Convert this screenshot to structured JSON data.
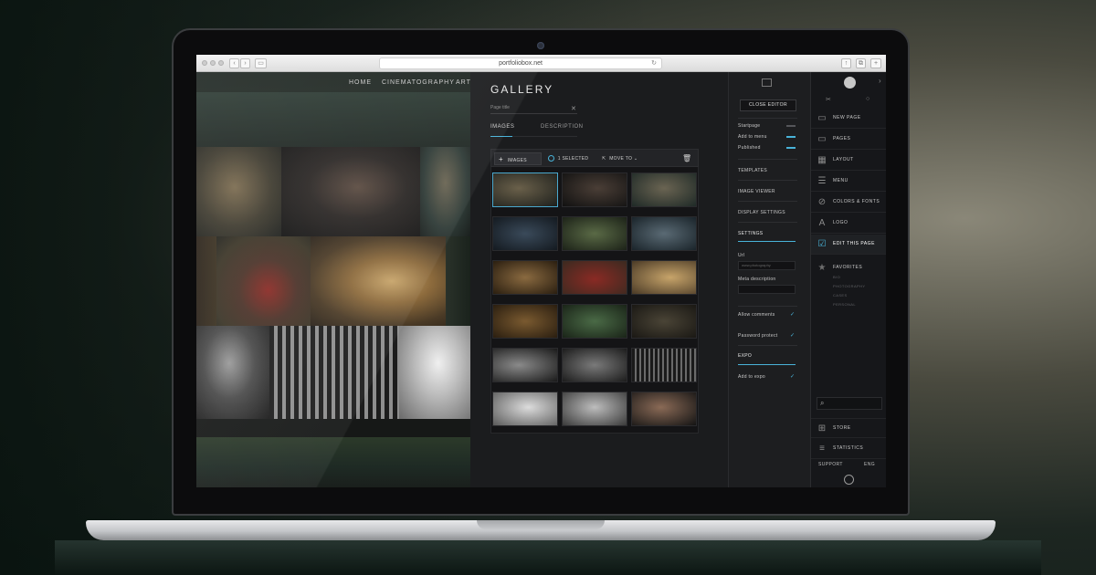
{
  "browser": {
    "url": "portfoliobox.net"
  },
  "site": {
    "nav": [
      "HOME",
      "CINEMATOGRAPHY",
      "ART"
    ]
  },
  "gallery": {
    "title": "GALLERY",
    "page_title_placeholder": "Page title",
    "close_glyph": "✕",
    "tabs": [
      "IMAGES",
      "DESCRIPTION"
    ],
    "toolbar": {
      "add_images": "IMAGES",
      "selected": "1 SELECTED",
      "move_to": "MOVE TO"
    }
  },
  "settings": {
    "close_editor": "CLOSE EDITOR",
    "toggles": [
      "Startpage",
      "Add to menu",
      "Published"
    ],
    "sections": [
      "TEMPLATES",
      "IMAGE VIEWER",
      "DISPLAY SETTINGS",
      "SETTINGS"
    ],
    "url_label": "Url",
    "url_value": "www.photography",
    "meta_label": "Meta description",
    "checks": [
      "Allow comments",
      "Password protect"
    ],
    "expo_heading": "EXPO",
    "add_to_expo": "Add to expo"
  },
  "menu": {
    "items": [
      "NEW PAGE",
      "PAGES",
      "LAYOUT",
      "MENU",
      "COLORS & FONTS",
      "LOGO",
      "EDIT THIS PAGE"
    ],
    "favorites": {
      "label": "FAVORITES",
      "items": [
        "BIO",
        "PHOTOGRAPHY",
        "CASES",
        "PERSONAL"
      ]
    },
    "store": "STORE",
    "statistics": "STATISTICS",
    "support": "SUPPORT",
    "language": "ENG"
  },
  "colors": {
    "accent": "#49b3d9",
    "panel": "#1b1c1e",
    "menu_bg": "#16171a"
  }
}
